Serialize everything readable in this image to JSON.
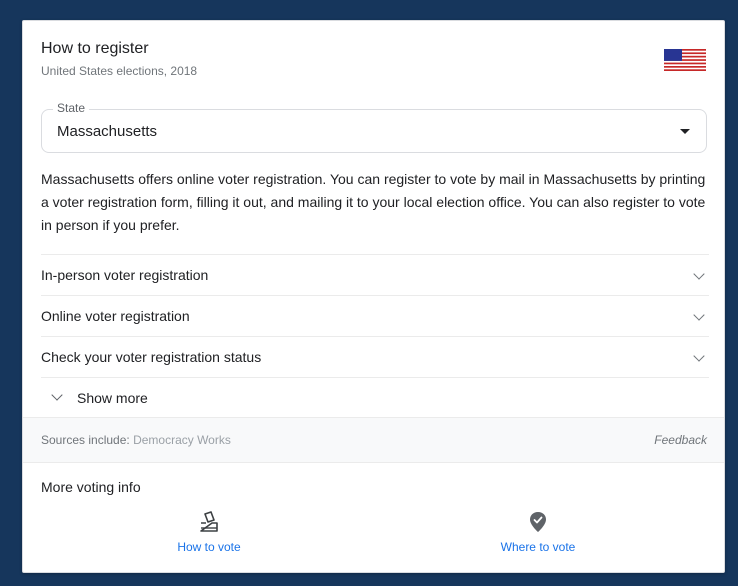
{
  "card": {
    "title": "How to register",
    "subtitle": "United States elections, 2018",
    "flag_icon": "us-flag-icon"
  },
  "state": {
    "label": "State",
    "value": "Massachusetts"
  },
  "description": "Massachusetts offers online voter registration. You can register to vote by mail in Massachusetts by printing a voter registration form, filling it out, and mailing it to your local election office. You can also register to vote in person if you prefer.",
  "accordion": [
    {
      "label": "In-person voter registration"
    },
    {
      "label": "Online voter registration"
    },
    {
      "label": "Check your voter registration status"
    }
  ],
  "show_more": {
    "label": "Show more"
  },
  "sources": {
    "prefix": "Sources include: ",
    "link": "Democracy Works",
    "feedback": "Feedback"
  },
  "more_voting": {
    "title": "More voting info",
    "actions": [
      {
        "label": "How to vote",
        "icon": "ballot-icon"
      },
      {
        "label": "Where to vote",
        "icon": "location-check-icon"
      }
    ]
  },
  "colors": {
    "background": "#16365c",
    "link": "#1a73e8",
    "secondary_text": "#70757a"
  }
}
